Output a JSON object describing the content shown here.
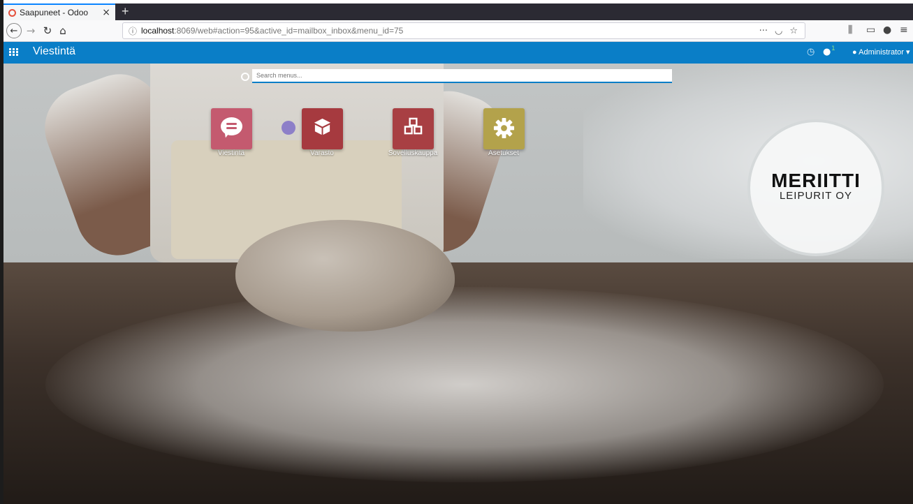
{
  "browser": {
    "tab_title": "Saapuneet - Odoo",
    "tab_close": "×",
    "new_tab": "+",
    "url_host": "localhost",
    "url_rest": ":8069/web#action=95&active_id=mailbox_inbox&menu_id=75",
    "url_more": "···",
    "info_icon": "ⓘ"
  },
  "odoo": {
    "app_title": "Viestintä",
    "user": "Administrator",
    "user_caret": "▾",
    "chat_count": "1",
    "search_placeholder": "Search menus..."
  },
  "apps": [
    {
      "label": "Viestintä",
      "icon": "chat-icon",
      "color": "#c45a6f"
    },
    {
      "label": "Varasto",
      "icon": "box-icon",
      "color": "#a63a3f"
    },
    {
      "label": "Sovelluskauppa",
      "icon": "cubes-icon",
      "color": "#a83f43"
    },
    {
      "label": "Asetukset",
      "icon": "gear-icon",
      "color": "#b3a24b"
    }
  ],
  "logo": {
    "line1": "MERIITTI",
    "line2": "LEIPURIT OY"
  },
  "colors": {
    "odoo_bar": "#0a7ec7",
    "tab_accent": "#0a84ff"
  }
}
